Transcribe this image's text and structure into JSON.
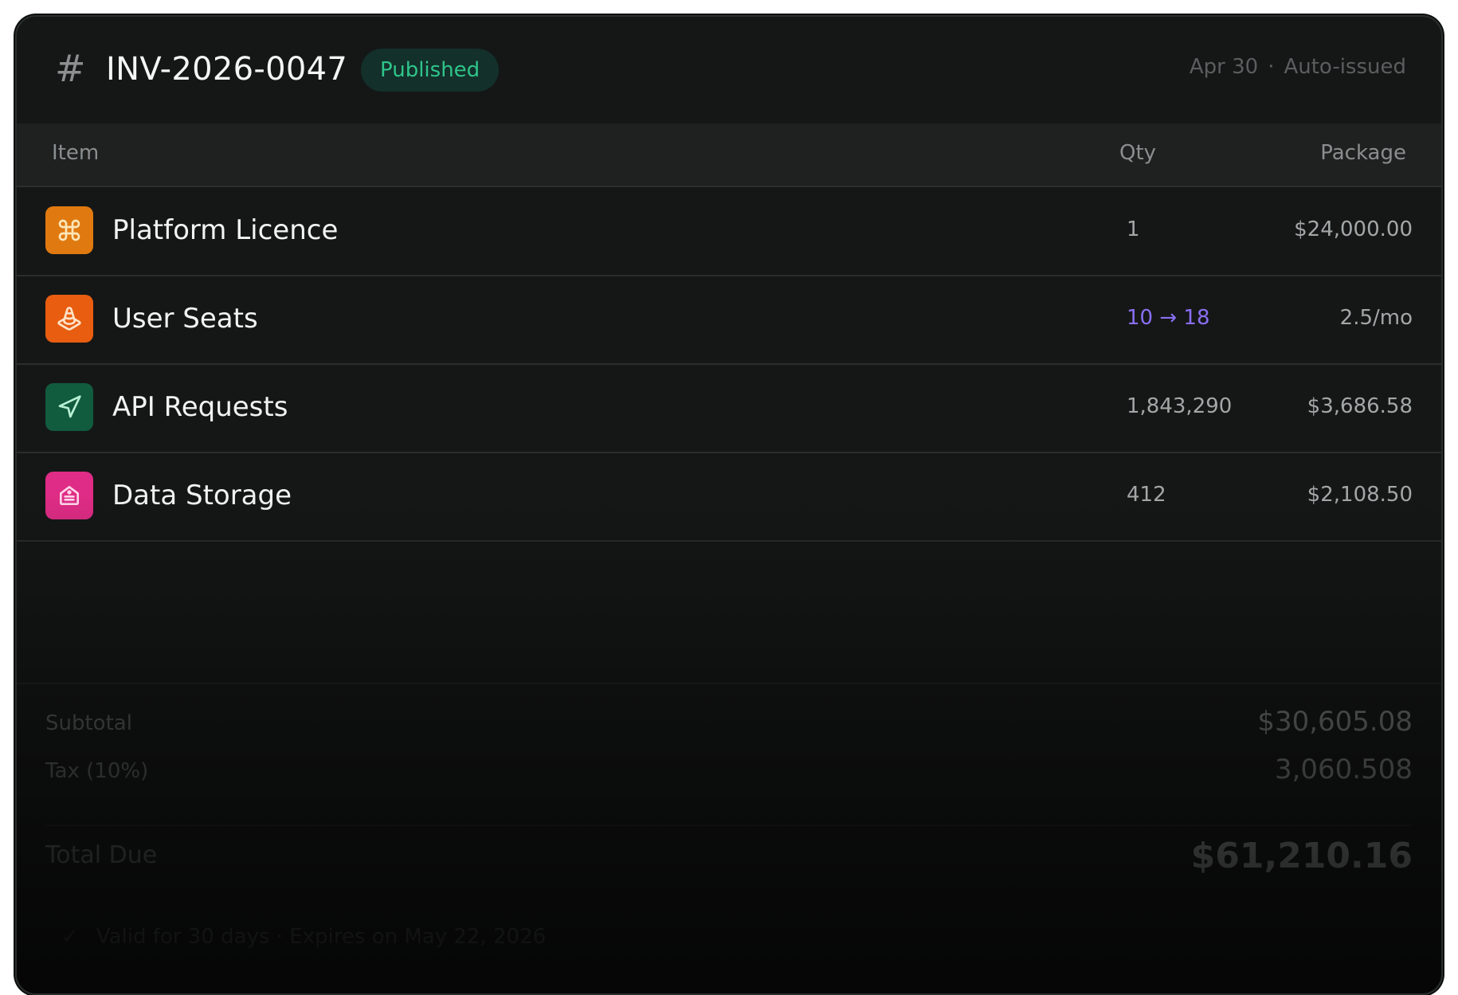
{
  "header": {
    "hash_symbol": "#",
    "invoice_id": "INV-2026-0047",
    "status": "Published",
    "date": "Apr 30",
    "separator": "·",
    "issue_type": "Auto-issued"
  },
  "table": {
    "columns": {
      "item": "Item",
      "qty": "Qty",
      "package": "Package"
    },
    "rows": [
      {
        "icon": "command-icon",
        "icon_color": "#e07a10",
        "name": "Platform Licence",
        "qty": "1",
        "package": "$24,000.00"
      },
      {
        "icon": "traffic-cone-icon",
        "icon_color": "#e85d10",
        "name": "User Seats",
        "qty": "10 → 18",
        "package": "2.5/mo"
      },
      {
        "icon": "send-icon",
        "icon_color": "#115b3e",
        "name": "API Requests",
        "qty": "1,843,290",
        "package": "$3,686.58"
      },
      {
        "icon": "tag-icon",
        "icon_color": "#df2c86",
        "name": "Data Storage",
        "qty": "412",
        "package": "$2,108.50"
      }
    ]
  },
  "totals": {
    "subtotal_label": "Subtotal",
    "subtotal_value": "$30,605.08",
    "tax_label": "Tax (10%)",
    "tax_value": "3,060.508",
    "total_label": "Total Due",
    "total_value": "$61,210.16"
  },
  "footer": {
    "check": "✓",
    "validity": "Valid for 30 days · Expires on  May 22, 2026"
  },
  "colors": {
    "background": "#151717",
    "status_green": "#2fc48a",
    "qty_change_purple": "#8a6ff2"
  }
}
